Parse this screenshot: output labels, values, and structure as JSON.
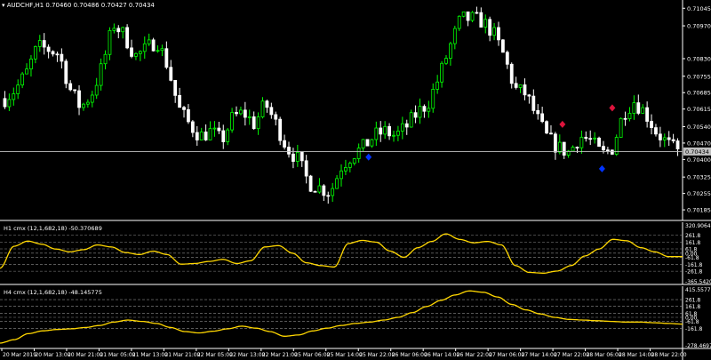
{
  "header": {
    "symbol_line": "AUDCHF,H1 0.70460 0.70486 0.70427 0.70434"
  },
  "colors": {
    "background": "#000000",
    "bull_candle": "#00ff00",
    "bear_candle": "#ffffff",
    "bid_line": "#c0c0c0",
    "indicator_line": "#ffd700",
    "sell_marker": "#dc143c",
    "buy_marker": "#0033ff",
    "grid_dash": "#8c8c8c",
    "axis_text": "#ffffff"
  },
  "chart_data": [
    {
      "type": "candlestick",
      "symbol": "AUDCHF",
      "timeframe": "H1",
      "ylim": [
        0.70155,
        0.71065
      ],
      "y_ticks": [
        "0.71045",
        "0.70970",
        "0.70830",
        "0.70755",
        "0.70685",
        "0.70615",
        "0.70540",
        "0.70470",
        "0.70400",
        "0.70325",
        "0.70255",
        "0.70185"
      ],
      "current_price_label": "0.70434",
      "current_price": 0.70434,
      "x_tick_labels": [
        "20 Mar 2019",
        "20 Mar 13:00",
        "20 Mar 21:00",
        "21 Mar 05:00",
        "21 Mar 13:00",
        "21 Mar 21:00",
        "22 Mar 05:00",
        "22 Mar 13:00",
        "22 Mar 21:00",
        "25 Mar 06:00",
        "25 Mar 14:00",
        "25 Mar 22:00",
        "26 Mar 06:00",
        "26 Mar 14:00",
        "26 Mar 22:00",
        "27 Mar 06:00",
        "27 Mar 14:00",
        "27 Mar 22:00",
        "28 Mar 06:00",
        "28 Mar 14:00",
        "28 Mar 22:00"
      ],
      "close_path": [
        0.7066,
        0.707,
        0.7077,
        0.7088,
        0.7087,
        0.7085,
        0.707,
        0.7062,
        0.7068,
        0.708,
        0.7098,
        0.7093,
        0.7084,
        0.7087,
        0.7091,
        0.708,
        0.7062,
        0.7055,
        0.705,
        0.7052,
        0.7048,
        0.7058,
        0.706,
        0.7055,
        0.7064,
        0.7055,
        0.7045,
        0.704,
        0.703,
        0.7028,
        0.7026,
        0.7037,
        0.7042,
        0.7045,
        0.705,
        0.7052,
        0.705,
        0.7054,
        0.706,
        0.7064,
        0.7075,
        0.7088,
        0.71,
        0.71,
        0.7099,
        0.7094,
        0.7084,
        0.707,
        0.7068,
        0.7058,
        0.7049,
        0.7045,
        0.7043,
        0.705,
        0.7048,
        0.7042,
        0.7045,
        0.706,
        0.7065,
        0.706,
        0.7052,
        0.7047,
        0.7043
      ],
      "sell_markers": [
        {
          "t": 0.824,
          "price": 0.7055
        },
        {
          "t": 0.897,
          "price": 0.7062
        }
      ],
      "buy_markers": [
        {
          "t": 0.54,
          "price": 0.7041
        },
        {
          "t": 0.882,
          "price": 0.7036
        }
      ]
    },
    {
      "type": "line",
      "label": "H1 cmx (12,1,682,18) -50.370689",
      "ylim": [
        -415,
        410
      ],
      "y_tick_labels": [
        "320.9064",
        "261.8",
        "161.8",
        "61.8",
        "0.00",
        "-61.8",
        "-161.8",
        "-261.8",
        "-365.5420"
      ],
      "levels": [
        261.8,
        161.8,
        61.8,
        0,
        -61.8,
        -161.8,
        -261.8
      ],
      "series": [
        {
          "values": [
            -220,
            100,
            175,
            130,
            60,
            20,
            50,
            120,
            90,
            10,
            -20,
            30,
            -20,
            -160,
            -150,
            -120,
            -90,
            -150,
            -110,
            90,
            110,
            0,
            -140,
            -180,
            -200,
            140,
            185,
            160,
            30,
            -60,
            80,
            170,
            280,
            200,
            150,
            170,
            120,
            -180,
            -280,
            -290,
            -260,
            -180,
            -40,
            60,
            200,
            180,
            80,
            20,
            -50,
            -50
          ]
        }
      ]
    },
    {
      "type": "line",
      "label": "H4 cmx (12,1,682,18) -48.145775",
      "ylim": [
        -420,
        420
      ],
      "y_tick_labels": [
        "415.5577",
        "261.8",
        "161.8",
        "61.8",
        "0.00",
        "-61.8",
        "-161.8",
        "-278.4697"
      ],
      "levels": [
        261.8,
        161.8,
        61.8,
        0,
        -61.8,
        -161.8
      ],
      "series": [
        {
          "values": [
            -380,
            -330,
            -240,
            -200,
            -180,
            -170,
            -150,
            -120,
            -70,
            -40,
            -60,
            -90,
            -150,
            -210,
            -230,
            -205,
            -170,
            -130,
            -160,
            -210,
            -280,
            -260,
            -200,
            -160,
            -120,
            -90,
            -70,
            -40,
            0,
            70,
            160,
            250,
            330,
            390,
            370,
            300,
            190,
            110,
            50,
            0,
            -30,
            -40,
            -50,
            -60,
            -70,
            -70,
            -80,
            -90,
            -100
          ]
        }
      ]
    }
  ]
}
